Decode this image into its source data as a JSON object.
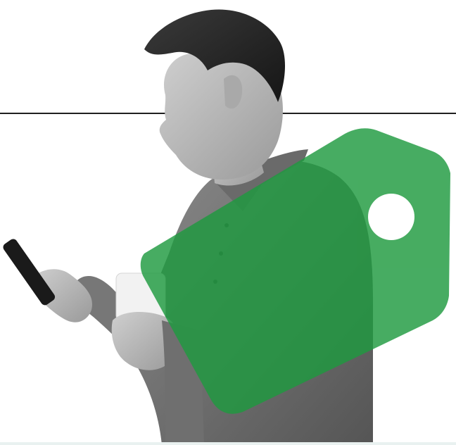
{
  "scene": {
    "subject": "man-holding-phone-and-mug",
    "tag_icon": "price-tag-icon",
    "colors": {
      "tag_green": "#22a046",
      "photo_gray": "#7d7d7d",
      "background": "#ffffff",
      "rule": "#1f1f1f"
    }
  }
}
